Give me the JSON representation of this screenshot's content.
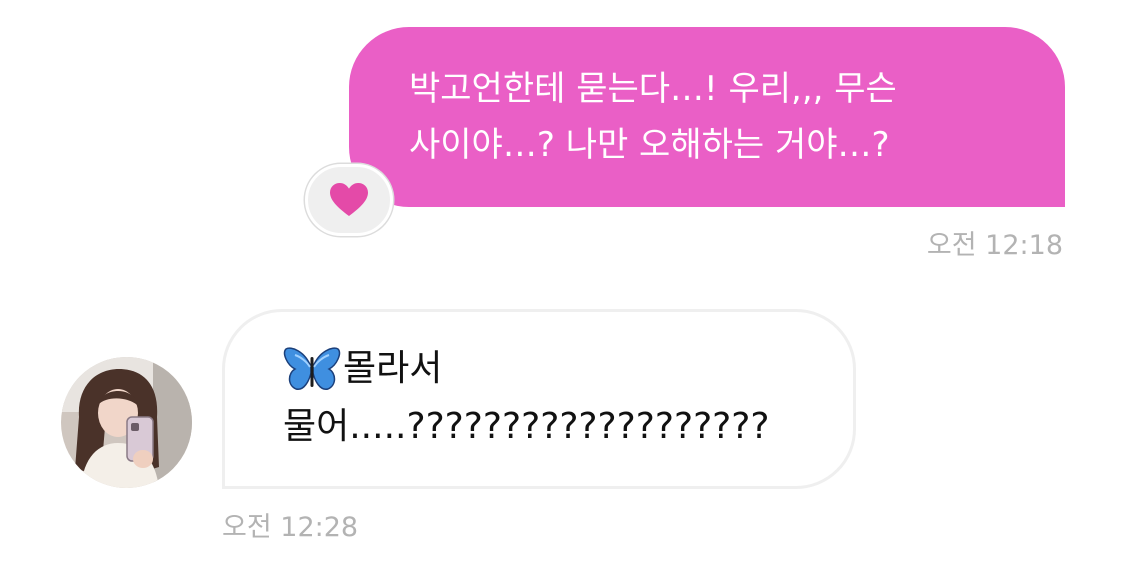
{
  "conversation": {
    "outgoing": {
      "lines": [
        "박고언한테 묻는다…! 우리,,, 무슨",
        "사이야…? 나만 오해하는 거야…?"
      ],
      "reaction": "heart-icon",
      "timestamp": "오전 12:18",
      "bubble_color": "#ea5fc6",
      "reaction_color": "#e44aa8"
    },
    "incoming": {
      "line1_icon": "butterfly-icon",
      "lines": [
        "몰라서",
        "물어.....???????????????????"
      ],
      "timestamp": "오전 12:28",
      "avatar": "avatar"
    }
  }
}
